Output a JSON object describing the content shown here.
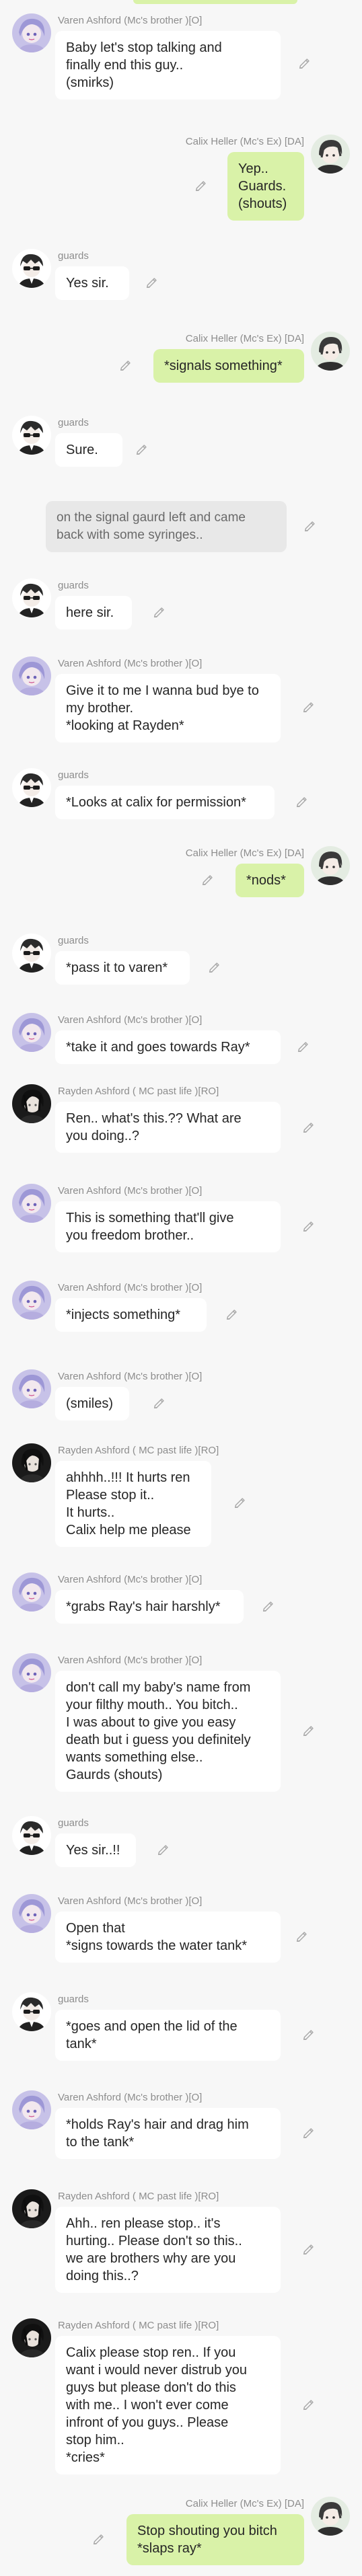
{
  "colors": {
    "background": "#f7f7f7",
    "bubble_white": "#ffffff",
    "bubble_green": "#d9f2a8",
    "bubble_narration": "#e8e8e8",
    "name_text": "#8d8d8d"
  },
  "icons": {
    "edit": "pencil-icon"
  },
  "messages": [
    {
      "name": "Varen Ashford (Mc's brother )[O]",
      "text": "Baby let's stop talking and\nfinally end this guy..\n(smirks)"
    },
    {
      "name": "Calix Heller (Mc's Ex) [DA]",
      "text": "Yep..\nGuards.\n(shouts)"
    },
    {
      "name": "guards",
      "text": "Yes sir."
    },
    {
      "name": "Calix Heller (Mc's Ex) [DA]",
      "text": "*signals something*"
    },
    {
      "name": "guards",
      "text": "Sure."
    },
    {
      "name": "",
      "text": "on the signal gaurd left and came\nback with some syringes.."
    },
    {
      "name": "guards",
      "text": "here sir."
    },
    {
      "name": "Varen Ashford (Mc's brother )[O]",
      "text": "Give it to me I wanna bud bye to\nmy brother.\n*looking at Rayden*"
    },
    {
      "name": "guards",
      "text": "*Looks at calix for permission*"
    },
    {
      "name": "Calix Heller (Mc's Ex) [DA]",
      "text": "*nods*"
    },
    {
      "name": "guards",
      "text": "*pass it to varen*"
    },
    {
      "name": "Varen Ashford (Mc's brother )[O]",
      "text": "*take it and goes towards Ray*"
    },
    {
      "name": "Rayden Ashford ( MC past life )[RO]",
      "text": "Ren.. what's this.?? What are\nyou doing..?"
    },
    {
      "name": "Varen Ashford (Mc's brother )[O]",
      "text": "This is something that'll give\nyou freedom brother.."
    },
    {
      "name": "Varen Ashford (Mc's brother )[O]",
      "text": "*injects something*"
    },
    {
      "name": "Varen Ashford (Mc's brother )[O]",
      "text": "(smiles)"
    },
    {
      "name": "Rayden Ashford ( MC past life )[RO]",
      "text": "ahhhh..!!! It hurts ren\nPlease stop it..\nIt hurts..\nCalix help me please"
    },
    {
      "name": "Varen Ashford (Mc's brother )[O]",
      "text": "*grabs Ray's hair harshly*"
    },
    {
      "name": "Varen Ashford (Mc's brother )[O]",
      "text": "don't call my baby's name from\nyour filthy mouth.. You bitch..\nI was about to give you easy\ndeath but i guess you definitely\nwants something else..\nGaurds (shouts)"
    },
    {
      "name": "guards",
      "text": "Yes sir..!!"
    },
    {
      "name": "Varen Ashford (Mc's brother )[O]",
      "text": "Open that\n*signs towards the water tank*"
    },
    {
      "name": "guards",
      "text": "*goes and open the lid of the\ntank*"
    },
    {
      "name": "Varen Ashford (Mc's brother )[O]",
      "text": "*holds Ray's hair and drag him\nto the tank*"
    },
    {
      "name": "Rayden Ashford ( MC past life )[RO]",
      "text": "Ahh.. ren please stop.. it's\nhurting.. Please don't so this..\nwe are brothers why are you\ndoing this..?"
    },
    {
      "name": "Rayden Ashford ( MC past life )[RO]",
      "text": "Calix please stop ren.. If you\nwant i would never distrub you\nguys but please don't do this\nwith me.. I won't ever come\ninfront of you guys.. Please\nstop him..\n*cries*"
    },
    {
      "name": "Calix Heller (Mc's Ex) [DA]",
      "text": "Stop shouting you bitch\n*slaps ray*"
    }
  ]
}
